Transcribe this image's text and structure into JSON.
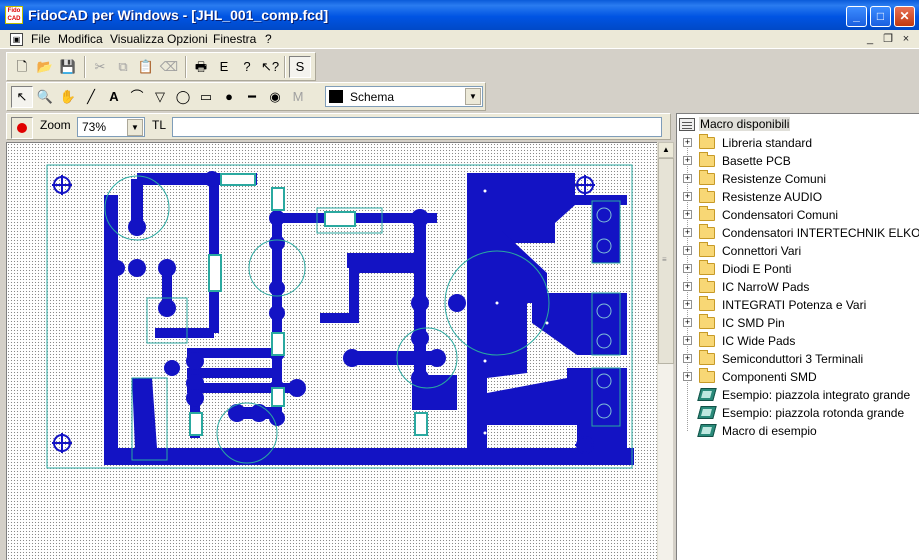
{
  "window": {
    "title": "FidoCAD per Windows - [JHL_001_comp.fcd]",
    "icon_text": "Fido CAD",
    "controls": {
      "minimize": "_",
      "maximize": "□",
      "close": "✕"
    }
  },
  "menubar": {
    "doc_icon": "document-icon",
    "items": [
      "File",
      "Modifica",
      "Visualizza",
      "Opzioni",
      "Finestra",
      "?"
    ],
    "mdi_controls": {
      "minimize": "_",
      "restore": "❐",
      "close": "×"
    }
  },
  "toolbar1": {
    "tools": [
      {
        "name": "new-icon",
        "glyph": "🗋"
      },
      {
        "name": "open-icon",
        "glyph": "📂"
      },
      {
        "name": "save-icon",
        "glyph": "💾"
      },
      {
        "name": "cut-icon",
        "glyph": "✂"
      },
      {
        "name": "copy-icon",
        "glyph": "⧉"
      },
      {
        "name": "paste-icon",
        "glyph": "📋"
      },
      {
        "name": "eraser-icon",
        "glyph": "⌫"
      },
      {
        "name": "print-icon",
        "glyph": "🖶"
      },
      {
        "name": "export-icon",
        "glyph": "E"
      },
      {
        "name": "help-icon",
        "glyph": "?"
      },
      {
        "name": "context-help-icon",
        "glyph": "↖?"
      },
      {
        "name": "snap-icon",
        "glyph": "S"
      }
    ]
  },
  "toolbar2": {
    "tools": [
      {
        "name": "select-arrow-icon",
        "glyph": "↖"
      },
      {
        "name": "zoom-icon",
        "glyph": "🔍"
      },
      {
        "name": "hand-icon",
        "glyph": "✋"
      },
      {
        "name": "line-icon",
        "glyph": "╱"
      },
      {
        "name": "text-icon",
        "glyph": "A"
      },
      {
        "name": "bezier-icon",
        "glyph": "⌒"
      },
      {
        "name": "polygon-icon",
        "glyph": "▽"
      },
      {
        "name": "ellipse-icon",
        "glyph": "◯"
      },
      {
        "name": "rectangle-icon",
        "glyph": "▭"
      },
      {
        "name": "pcb-pad-icon",
        "glyph": "●"
      },
      {
        "name": "pcb-line-icon",
        "glyph": "━"
      },
      {
        "name": "connection-icon",
        "glyph": "◉"
      },
      {
        "name": "macro-icon",
        "glyph": "M"
      }
    ],
    "layer": {
      "label": "Schema",
      "color": "#000000"
    }
  },
  "zoombar": {
    "zoom_label": "Zoom",
    "zoom_value": "73%",
    "tl_label": "TL",
    "tl_value": ""
  },
  "colors": {
    "pcb_copper": "#1313c4",
    "board_outline": "#2aa9a0",
    "canvas_dots": "#888888"
  },
  "macro_tree": {
    "root": "Macro disponibili",
    "folders": [
      "Libreria standard",
      "Basette PCB",
      "Resistenze Comuni",
      "Resistenze AUDIO",
      "Condensatori Comuni",
      "Condensatori INTERTECHNIK ELKO",
      "Connettori Vari",
      "Diodi E Ponti",
      "IC NarroW Pads",
      "INTEGRATI Potenza e Vari",
      "IC SMD Pin",
      "IC Wide Pads",
      "Semiconduttori 3 Terminali",
      "Componenti SMD"
    ],
    "macros": [
      "Esempio: piazzola integrato grande",
      "Esempio: piazzola rotonda grande",
      "Macro di esempio"
    ]
  }
}
